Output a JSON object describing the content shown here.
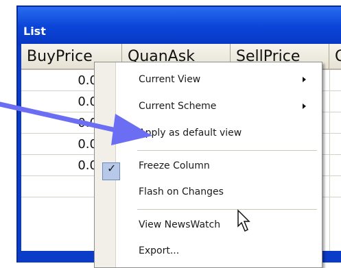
{
  "window": {
    "title": "List"
  },
  "grid": {
    "columns": [
      "BuyPrice",
      "QuanAsk",
      "SellPrice",
      "Q"
    ],
    "rows": [
      {
        "buy_price": "0.0"
      },
      {
        "buy_price": "0.0"
      },
      {
        "buy_price": "0.0"
      },
      {
        "buy_price": "0.0"
      },
      {
        "buy_price": "0.0"
      },
      {
        "buy_price": ""
      }
    ]
  },
  "context_menu": {
    "items": [
      {
        "label": "Current View",
        "submenu": true
      },
      {
        "label": "Current Scheme",
        "submenu": true
      },
      {
        "label": "Apply as default view"
      },
      {
        "label": "Freeze Column"
      },
      {
        "label": "Flash on Changes",
        "checked": true,
        "check_glyph": "✓"
      },
      {
        "label": "View NewsWatch"
      },
      {
        "label": "Export..."
      }
    ]
  },
  "colors": {
    "window_blue": "#0a3cc8",
    "annotation_arrow": "#6b6ef2",
    "menu_check_bg": "#b7c8e8"
  },
  "icons": [
    "submenu-arrow-icon",
    "checkmark-icon",
    "mouse-cursor-icon",
    "annotation-arrow"
  ]
}
